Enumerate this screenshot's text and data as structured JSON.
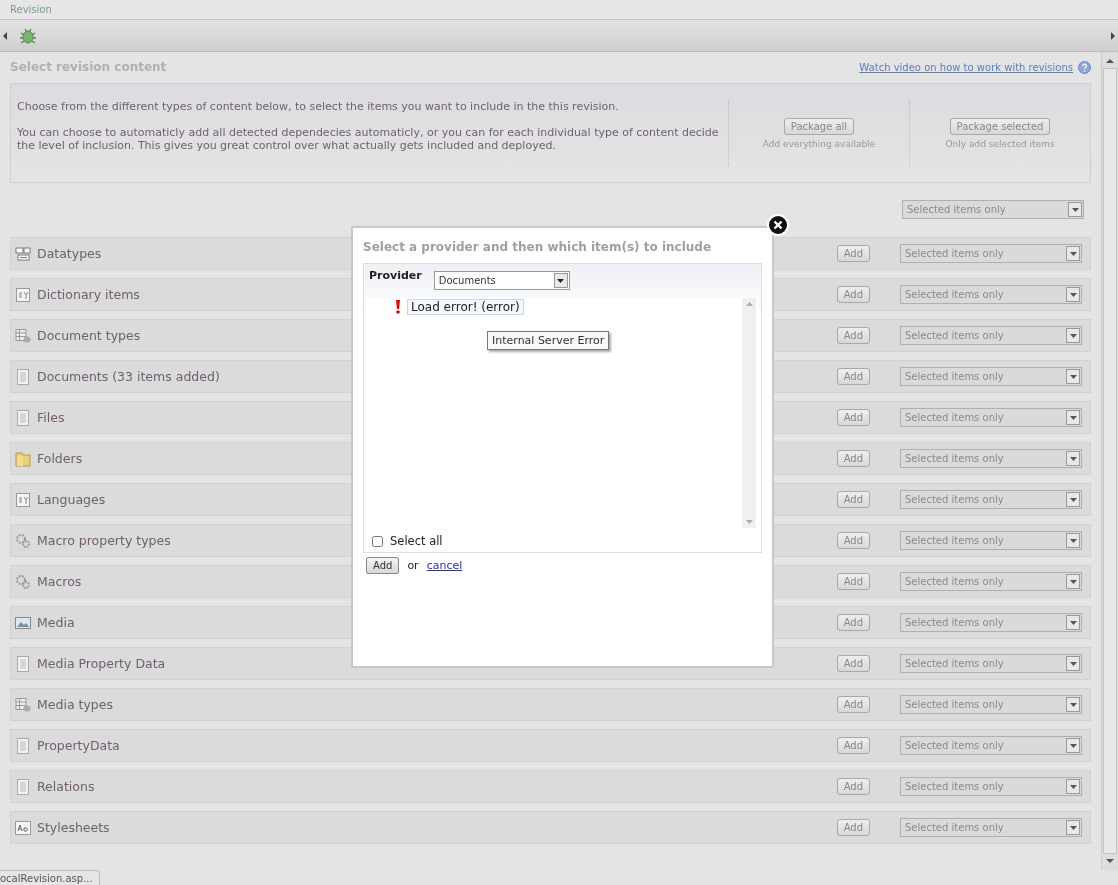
{
  "window": {
    "title": "Revision"
  },
  "page": {
    "title": "Select revision content",
    "help_link": "Watch video on how to work with revisions"
  },
  "intro": {
    "paragraphs": [
      "Choose from the different types of content below, to select the items you want to include in the this revision.",
      "You can choose to automaticly add all detected dependecies automaticly, or you can for each individual type of content decide the level of inclusion. This gives you great control over what actually gets included and deployed."
    ]
  },
  "package_actions": [
    {
      "label": "Package all",
      "hint": "Add everything available"
    },
    {
      "label": "Package selected",
      "hint": "Only add selected items"
    }
  ],
  "default_inclusion": "Selected items only",
  "content_types": [
    {
      "kind": "datatype",
      "label": "Datatypes",
      "add": "Add",
      "inclusion": "Selected items only"
    },
    {
      "kind": "dictionary",
      "label": "Dictionary items",
      "add": "Add",
      "inclusion": "Selected items only"
    },
    {
      "kind": "doctype",
      "label": "Document types",
      "add": "Add",
      "inclusion": "Selected items only"
    },
    {
      "kind": "document",
      "label": "Documents (33 items added)",
      "add": "Add",
      "inclusion": "Selected items only"
    },
    {
      "kind": "document",
      "label": "Files",
      "add": "Add",
      "inclusion": "Selected items only"
    },
    {
      "kind": "folder",
      "label": "Folders",
      "add": "Add",
      "inclusion": "Selected items only"
    },
    {
      "kind": "dictionary",
      "label": "Languages",
      "add": "Add",
      "inclusion": "Selected items only"
    },
    {
      "kind": "macro",
      "label": "Macro property types",
      "add": "Add",
      "inclusion": "Selected items only"
    },
    {
      "kind": "macro",
      "label": "Macros",
      "add": "Add",
      "inclusion": "Selected items only"
    },
    {
      "kind": "media",
      "label": "Media",
      "add": "Add",
      "inclusion": "Selected items only"
    },
    {
      "kind": "document",
      "label": "Media Property Data",
      "add": "Add",
      "inclusion": "Selected items only"
    },
    {
      "kind": "doctype",
      "label": "Media types",
      "add": "Add",
      "inclusion": "Selected items only"
    },
    {
      "kind": "document",
      "label": "PropertyData",
      "add": "Add",
      "inclusion": "Selected items only"
    },
    {
      "kind": "document",
      "label": "Relations",
      "add": "Add",
      "inclusion": "Selected items only"
    },
    {
      "kind": "stylesheet",
      "label": "Stylesheets",
      "add": "Add",
      "inclusion": "Selected items only"
    }
  ],
  "dialog": {
    "title": "Select a provider and then which item(s) to include",
    "provider_label": "Provider",
    "provider_value": "Documents",
    "items": [
      {
        "kind": "error",
        "label": "Load error! (error)"
      }
    ],
    "tooltip": "Internal Server Error",
    "select_all": {
      "label": "Select all",
      "checked": false
    },
    "add": "Add",
    "or_text": "or",
    "cancel": "cancel"
  },
  "status_tab": "ocalRevision.asp..."
}
